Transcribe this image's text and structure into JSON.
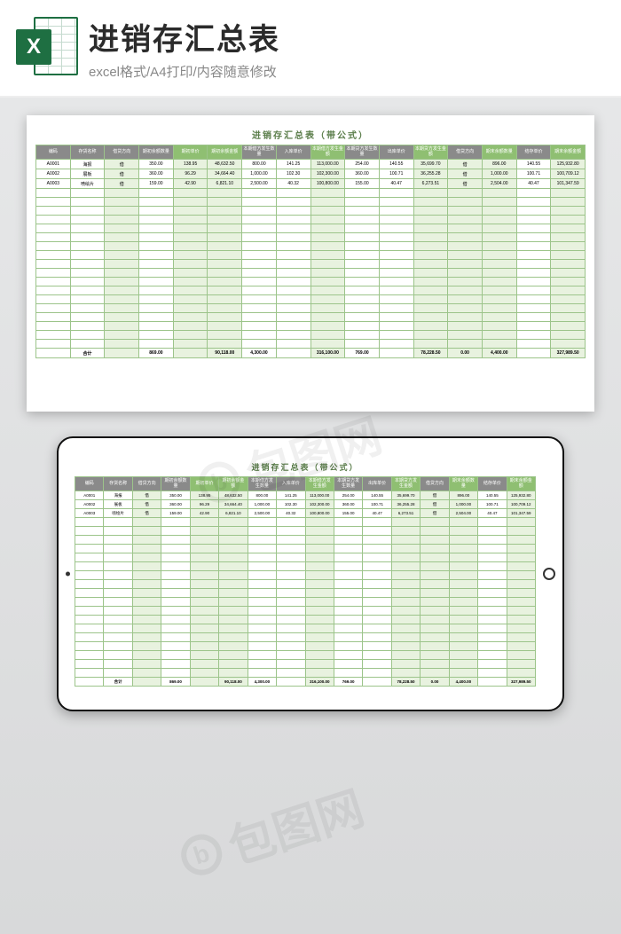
{
  "header": {
    "title": "进销存汇总表",
    "subtitle": "excel格式/A4打印/内容随意修改",
    "icon_letter": "X"
  },
  "watermark": "包图网",
  "sheet": {
    "title": "进销存汇总表（带公式）",
    "columns": [
      {
        "label": "编码",
        "cls": "h-grey",
        "col": "c-white"
      },
      {
        "label": "存货名称",
        "cls": "h-grey",
        "col": "c-white"
      },
      {
        "label": "借贷方向",
        "cls": "h-grey",
        "col": "c-tint"
      },
      {
        "label": "期初余额数量",
        "cls": "h-grey",
        "col": "c-white"
      },
      {
        "label": "期初单价",
        "cls": "h-green",
        "col": "c-tint"
      },
      {
        "label": "期初余额金额",
        "cls": "h-green",
        "col": "c-tint"
      },
      {
        "label": "本期借方发生数量",
        "cls": "h-grey",
        "col": "c-white"
      },
      {
        "label": "入库单价",
        "cls": "h-grey",
        "col": "c-white"
      },
      {
        "label": "本期借方发生金额",
        "cls": "h-green",
        "col": "c-tint"
      },
      {
        "label": "本期贷方发生数量",
        "cls": "h-grey",
        "col": "c-white"
      },
      {
        "label": "出库单价",
        "cls": "h-grey",
        "col": "c-white"
      },
      {
        "label": "本期贷方发生金额",
        "cls": "h-green",
        "col": "c-tint"
      },
      {
        "label": "借贷方向",
        "cls": "h-grey",
        "col": "c-tint"
      },
      {
        "label": "期末余额数量",
        "cls": "h-green",
        "col": "c-tint"
      },
      {
        "label": "结存单价",
        "cls": "h-grey",
        "col": "c-white"
      },
      {
        "label": "期末余额金额",
        "cls": "h-green",
        "col": "c-tint"
      }
    ],
    "rows": [
      [
        "A0001",
        "海报",
        "借",
        "350.00",
        "138.95",
        "48,632.50",
        "800.00",
        "141.25",
        "113,000.00",
        "254.00",
        "140.55",
        "35,699.70",
        "借",
        "896.00",
        "140.55",
        "125,932.80"
      ],
      [
        "A0002",
        "展板",
        "借",
        "360.00",
        "96.29",
        "34,664.40",
        "1,000.00",
        "102.30",
        "102,300.00",
        "360.00",
        "100.71",
        "36,255.28",
        "借",
        "1,000.00",
        "100.71",
        "100,709.12"
      ],
      [
        "A0003",
        "喷绘片",
        "借",
        "159.00",
        "42.90",
        "6,821.10",
        "2,500.00",
        "40.32",
        "100,800.00",
        "155.00",
        "40.47",
        "6,273.51",
        "借",
        "2,504.00",
        "40.47",
        "101,347.59"
      ]
    ],
    "empty_rows": 18,
    "total_label": "合计",
    "totals": [
      "",
      "合计",
      "",
      "869.00",
      "",
      "90,118.00",
      "4,300.00",
      "",
      "316,100.00",
      "769.00",
      "",
      "78,228.50",
      "0.00",
      "4,400.00",
      "",
      "327,989.50"
    ]
  }
}
